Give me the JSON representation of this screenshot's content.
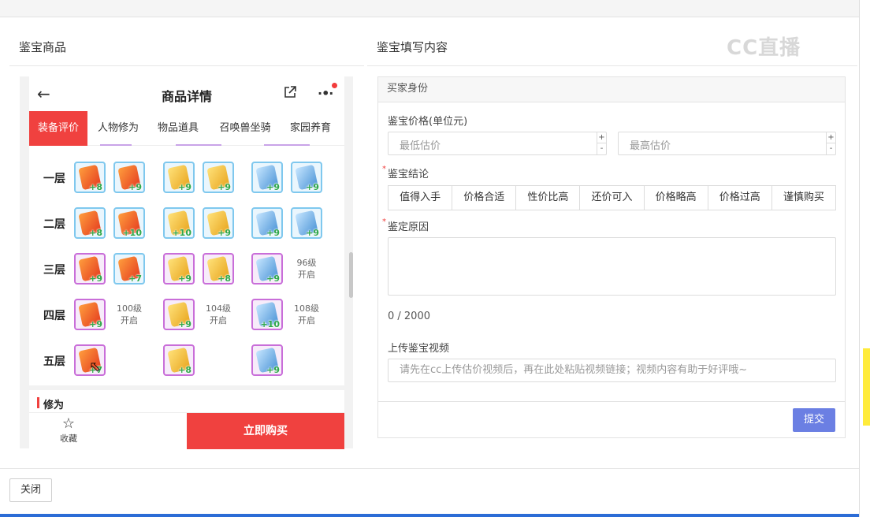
{
  "left_panel": {
    "title": "鉴宝商品",
    "phone": {
      "header_title": "商品详情",
      "back_icon": "arrow-left-icon",
      "share_icon": "share-icon",
      "more_icon": "more-icon",
      "tabs": [
        {
          "label": "装备评价",
          "active": true
        },
        {
          "label": "人物修为",
          "active": false
        },
        {
          "label": "物品道具",
          "active": false
        },
        {
          "label": "召唤兽坐骑",
          "active": false
        },
        {
          "label": "家园养育",
          "active": false
        }
      ],
      "rows": [
        {
          "label": "一层",
          "items": [
            "+8",
            "+9",
            "+9",
            "+9",
            "+9",
            "+9"
          ]
        },
        {
          "label": "二层",
          "items": [
            "+8",
            "+10",
            "+10",
            "+9",
            "+9",
            "+9"
          ]
        },
        {
          "label": "三层",
          "items": [
            "+9",
            "+7",
            "+9",
            "+8",
            "+9",
            "96级 开启"
          ]
        },
        {
          "label": "四层",
          "items": [
            "+9",
            "100级 开启",
            "+9",
            "104级 开启",
            "+10",
            "108级 开启"
          ]
        },
        {
          "label": "五层",
          "items": [
            "+7",
            "",
            "+8",
            "",
            "+9",
            ""
          ]
        }
      ],
      "section_label": "修为",
      "favorite_label": "收藏",
      "buy_label": "立即购买",
      "accent_color": "#f0413f"
    }
  },
  "right_panel": {
    "title": "鉴宝填写内容",
    "watermark": "CC直播",
    "form": {
      "header": "买家身份",
      "price_label": "鉴宝价格(单位元)",
      "min_placeholder": "最低估价",
      "max_placeholder": "最高估价",
      "conclusion_label": "鉴宝结论",
      "conclusions": [
        "值得入手",
        "价格合适",
        "性价比高",
        "还价可入",
        "价格略高",
        "价格过高",
        "谨慎购买"
      ],
      "reason_label": "鉴定原因",
      "counter": "0 / 2000",
      "video_label": "上传鉴宝视频",
      "video_placeholder": "请先在cc上传估价视频后，再在此处粘贴视频链接；视频内容有助于好评哦~",
      "submit_label": "提交",
      "submit_color": "#6b7fe3"
    }
  },
  "footer": {
    "close_label": "关闭"
  }
}
